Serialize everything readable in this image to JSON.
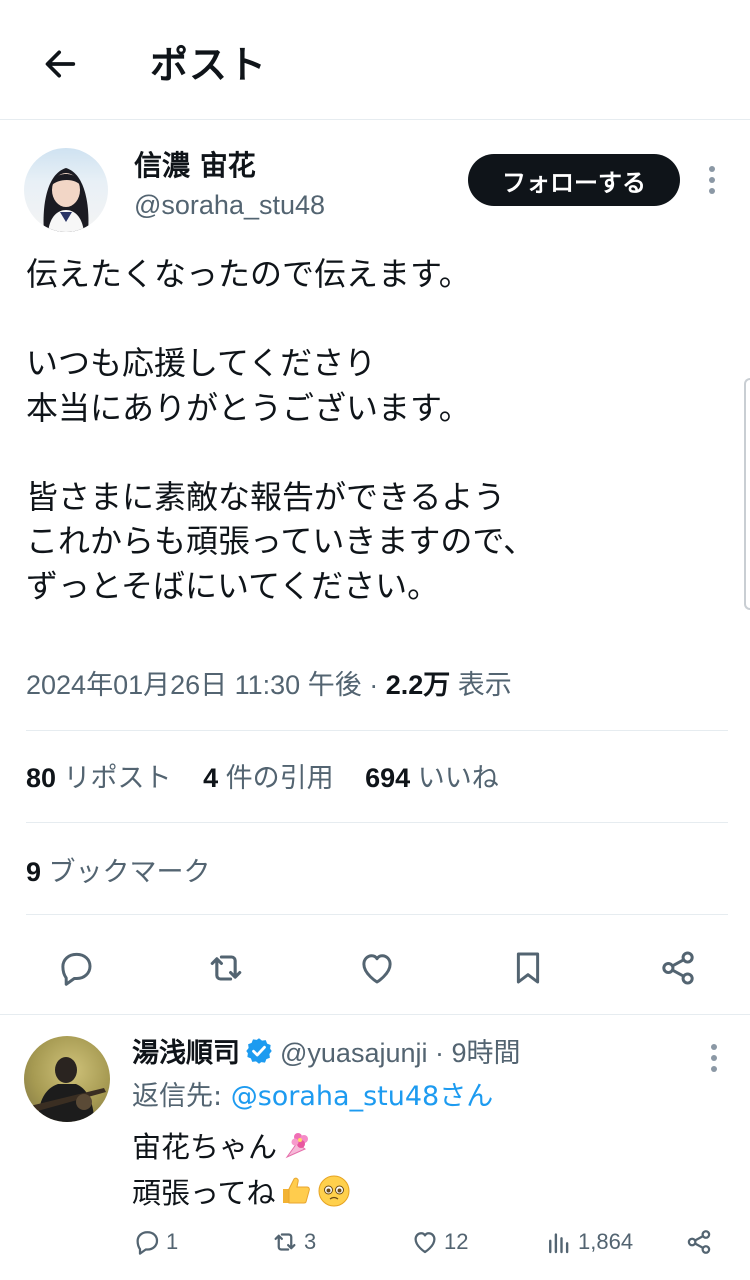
{
  "header": {
    "title": "ポスト",
    "back_icon": "arrow-left-icon"
  },
  "author": {
    "name": "信濃 宙花",
    "handle": "@soraha_stu48",
    "follow_label": "フォローする",
    "more_icon": "more-vertical-icon"
  },
  "post": {
    "lines": [
      "伝えたくなったので伝えます。",
      "",
      "いつも応援してくださり",
      "本当にありがとうございます。",
      "",
      "皆さまに素敵な報告ができるよう",
      "これからも頑張っていきますので、",
      "ずっとそばにいてください。"
    ],
    "timestamp": "2024年01月26日 11:30 午後",
    "separator": " · ",
    "views": "2.2万",
    "views_label": " 表示"
  },
  "stats": {
    "reposts": "80",
    "reposts_label": " リポスト",
    "quotes": "4",
    "quotes_label": " 件の引用",
    "likes": "694",
    "likes_label": " いいね",
    "bookmarks": "9",
    "bookmarks_label": " ブックマーク"
  },
  "actions": [
    "reply-icon",
    "repost-icon",
    "like-icon",
    "bookmark-icon",
    "share-icon"
  ],
  "reply": {
    "name": "湯浅順司",
    "handle": "@yuasajunji",
    "dot": " · ",
    "time": "9時間",
    "replying_to_label": "返信先: ",
    "replying_to_handle": "@soraha_stu48さん",
    "line1": "宙花ちゃん",
    "line2": "頑張ってね",
    "reply_count": "1",
    "repost_count": "3",
    "like_count": "12",
    "view_count": "1,864"
  },
  "colors": {
    "text": "#0f1419",
    "secondary": "#536471",
    "link": "#1d9bf0",
    "divider": "#e6ecf0",
    "follow_bg": "#0f1419"
  }
}
